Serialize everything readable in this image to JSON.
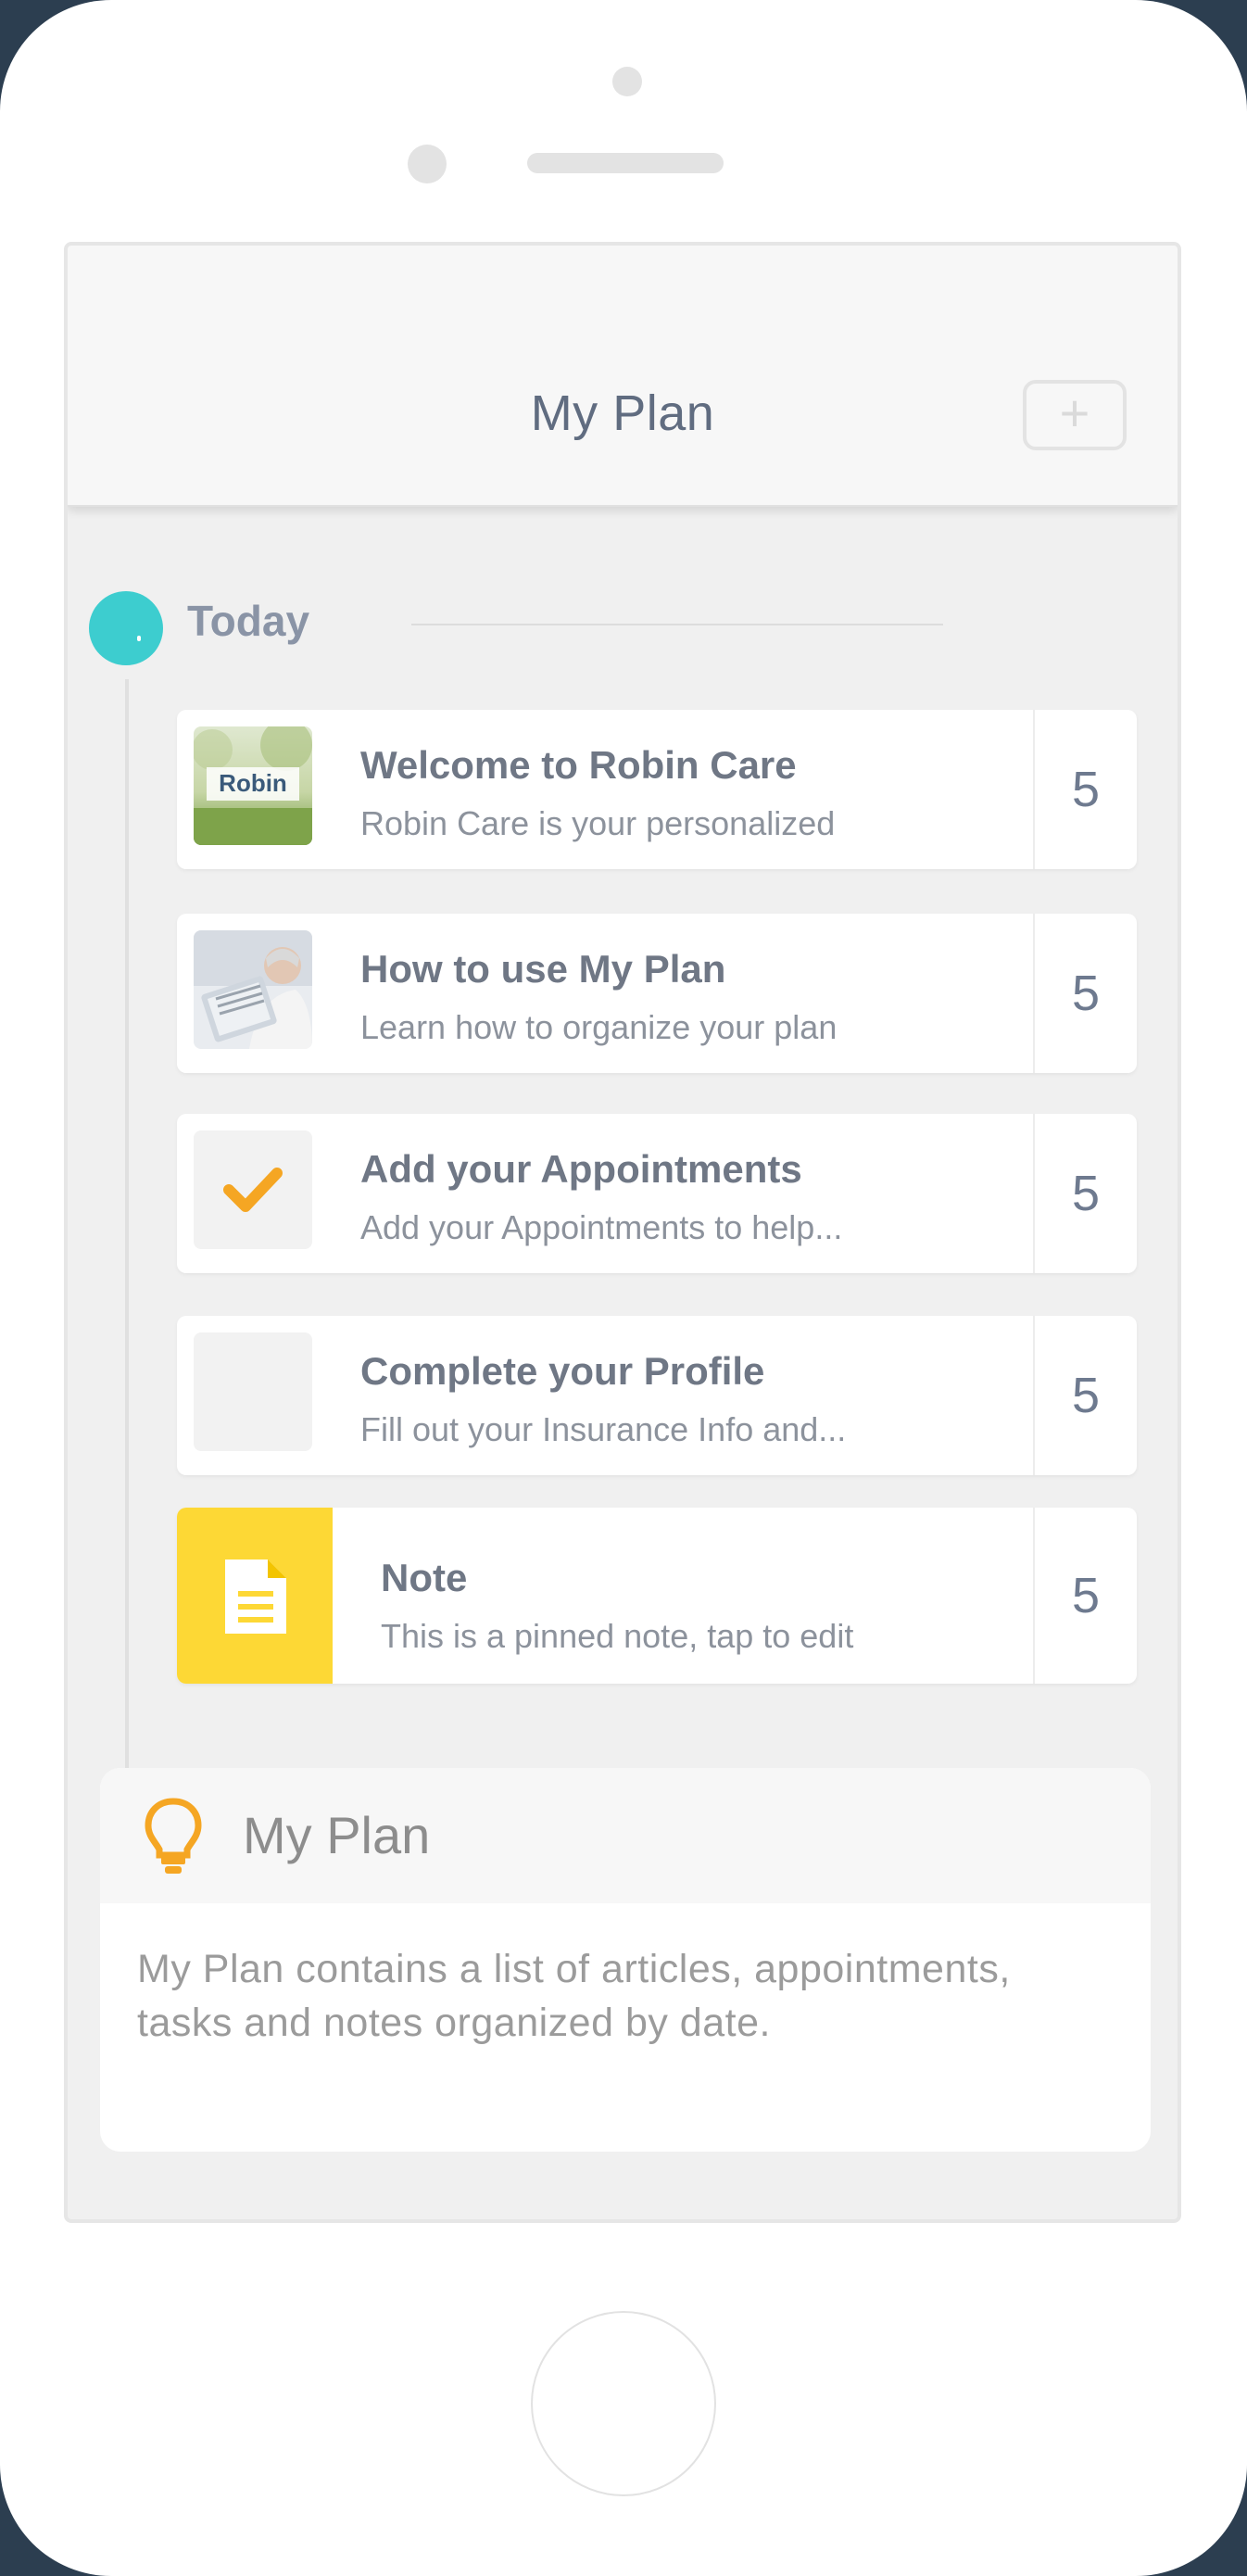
{
  "header": {
    "title": "My Plan",
    "add_label": "+"
  },
  "timeline": {
    "day_label": "Today"
  },
  "items": [
    {
      "title": "Welcome to Robin Care",
      "description": "Robin Care is your personalized",
      "count": "5",
      "thumb": "robin-logo-image"
    },
    {
      "title": "How to use My Plan",
      "description": "Learn how to organize your plan",
      "count": "5",
      "thumb": "woman-reading-image"
    },
    {
      "title": "Add your Appointments",
      "description": "Add your Appointments to help...",
      "count": "5",
      "thumb": "checkmark-icon",
      "completed": true
    },
    {
      "title": "Complete your Profile",
      "description": "Fill out your Insurance Info and...",
      "count": "5",
      "thumb": "empty-checkbox",
      "completed": false
    },
    {
      "title": "Note",
      "description": "This is a pinned note, tap to edit",
      "count": "5",
      "thumb": "document-icon"
    }
  ],
  "logo_text": "Robin",
  "tip": {
    "title": "My Plan",
    "body": "My Plan contains a list of articles, appointments, tasks and notes organized by date.",
    "icon": "lightbulb-icon"
  },
  "colors": {
    "accent_teal": "#3dcdcf",
    "checkmark_orange": "#f5a623",
    "note_yellow": "#fdd835",
    "lightbulb_orange": "#f5a623"
  }
}
